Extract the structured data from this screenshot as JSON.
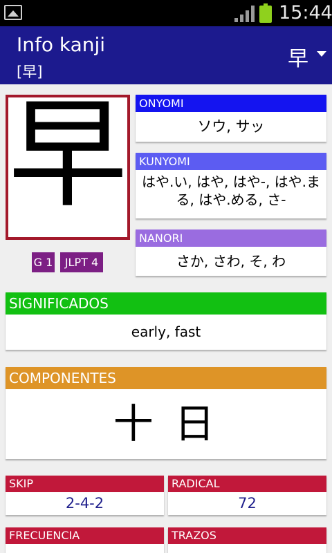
{
  "status_bar": {
    "time": "15:44",
    "icons": [
      "image-notification-icon",
      "signal-icon",
      "battery-icon"
    ]
  },
  "action_bar": {
    "title": "Info kanji",
    "subtitle": "[早]",
    "selected_kanji": "早"
  },
  "kanji": {
    "character": "早",
    "grade_badge": "G 1",
    "jlpt_badge": "JLPT 4"
  },
  "readings": {
    "onyomi": {
      "label": "ONYOMI",
      "value": "ソウ, サッ"
    },
    "kunyomi": {
      "label": "KUNYOMI",
      "value": "はや.い, はや, はや-, はや.まる, はや.める, さ-"
    },
    "nanori": {
      "label": "NANORI",
      "value": "さか, さわ, そ, わ"
    }
  },
  "meanings": {
    "label": "SIGNIFICADOS",
    "value": "early, fast"
  },
  "components": {
    "label": "COMPONENTES",
    "value": "十 日"
  },
  "details": {
    "skip": {
      "label": "SKIP",
      "value": "2-4-2"
    },
    "radical": {
      "label": "RADICAL",
      "value": "72"
    },
    "frequency": {
      "label": "FRECUENCIA"
    },
    "strokes": {
      "label": "TRAZOS"
    }
  },
  "colors": {
    "action_bar": "#1c1a8e",
    "onyomi": "#1414f0",
    "kunyomi": "#5c5cf2",
    "nanori": "#9a6ce0",
    "meanings": "#12c012",
    "components": "#de9427",
    "details": "#c1183a",
    "badge": "#7c1f84",
    "kanji_border": "#a3192b"
  }
}
